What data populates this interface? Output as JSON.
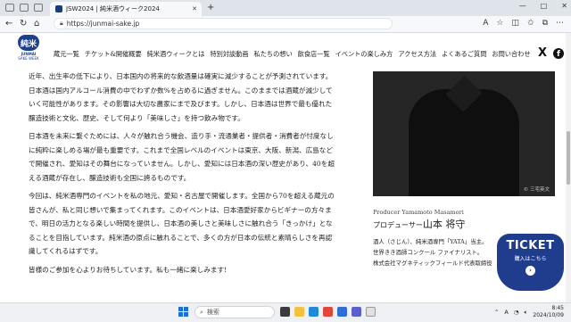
{
  "browser": {
    "tab_title": "JSW2024 | 純米酒ウィーク2024",
    "url": "https://junmai-sake.jp",
    "new_tab": "+",
    "window_buttons": [
      "—",
      "□",
      "✕"
    ]
  },
  "site": {
    "logo_mark": "純米",
    "logo_caption": "JUNMAI",
    "logo_caption2": "SAKE WEEK",
    "nav": [
      "蔵元一覧",
      "チケット&開催概要",
      "純米酒ウィークとは",
      "特別対談動画",
      "私たちの想い",
      "飲食店一覧",
      "イベントの楽しみ方",
      "アクセス方法",
      "よくあるご質問",
      "お問い合わせ"
    ],
    "social": {
      "x": "X",
      "facebook": "f"
    }
  },
  "article": {
    "paragraphs": [
      "近年、出生率の低下により、日本国内の将来的な飲酒量は確実に減少することが予測されています。日本酒は国内アルコール消費の中でわずか数%を占めるに過ぎません。このままでは酒蔵が減少していく可能性があります。その影響は大切な農家にまで及びます。しかし、日本酒は世界で最も優れた醸造技術と文化、歴史、そして何より「美味しさ」を持つ飲み物です。",
      "日本酒を未来に繋ぐためには、人々が触れ合う機会、造り手・流通業者・提供者・消費者が忖度なしに純粋に楽しめる場が最も重要です。これまで全国レベルのイベントは東京、大阪、新潟、広島などで開催され、愛知はその舞台になっていません。しかし、愛知には日本酒の深い歴史があり、40を超える酒蔵が存在し、醸造技術も全国に誇るものです。",
      "今回は、純米酒専門のイベントを私の地元、愛知・名古屋で開催します。全国から70を超える蔵元の皆さんが、私と同じ想いで集まってくれます。このイベントは、日本酒愛好家からビギナーの方々まで、明日の活力となる楽しい時間を提供し、日本酒の美しさと美味しさに触れ合う「きっかけ」となることを目指しています。純米酒の原点に触れることで、多くの方が日本の伝統と素晴らしさを再認識してくれるはずです。",
      "皆様のご参加を心よりお待ちしています。私も一緒に楽しみます!"
    ]
  },
  "profile": {
    "photo_credit": "© 三宅英文",
    "name_en": "Producer Yamamoto Masamori",
    "role": "プロデューサー",
    "name_jp": "山本 将守",
    "desc": [
      "酒人（さじん）、純米酒専門「YATA」当主。",
      "世界きき酒師コンクール ファイナリスト。",
      "株式会社マグネティックフィールド代表取締役"
    ]
  },
  "ticket": {
    "title": "TICKET",
    "sub": "購入はこちら",
    "arrow": "›"
  },
  "taskbar": {
    "search_placeholder": "検索",
    "time": "8:45",
    "date": "2024/10/09",
    "lang": "A"
  },
  "colors": {
    "brand": "#1f3d8c",
    "accent_windows": "#1f6fd1"
  }
}
